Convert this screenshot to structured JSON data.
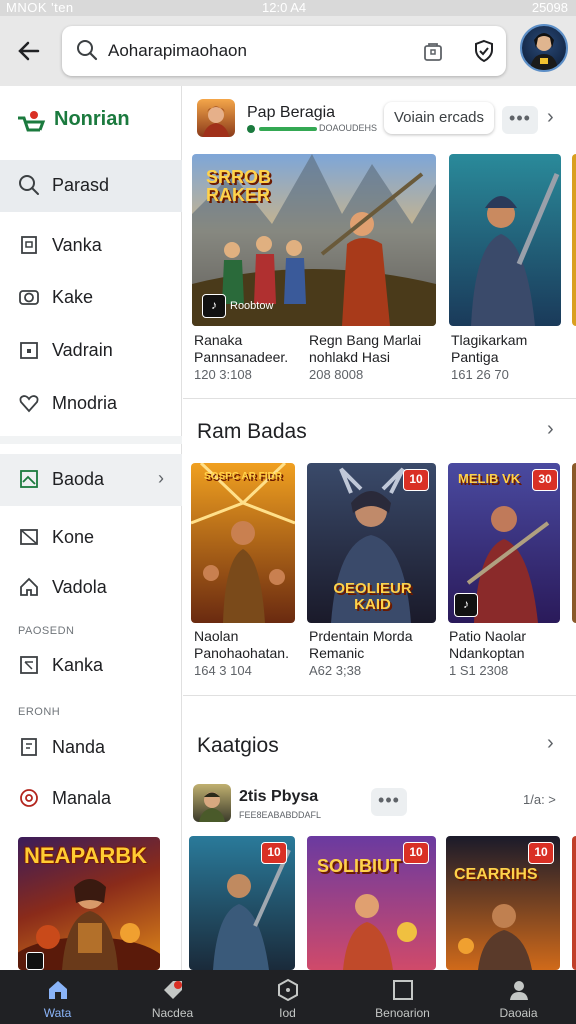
{
  "status": {
    "left": "MNOK 'ten",
    "time": "12:0 A4",
    "right": "25098"
  },
  "search": {
    "value": "Aoharapimaohaon",
    "placeholder": ""
  },
  "sidebar": {
    "brand": "Nonrian",
    "items": [
      {
        "label": "Parasd",
        "icon": "search-icon"
      },
      {
        "label": "Vanka",
        "icon": "document-icon"
      },
      {
        "label": "Kake",
        "icon": "camera-icon"
      },
      {
        "label": "Vadrain",
        "icon": "calendar-icon"
      },
      {
        "label": "Mnodria",
        "icon": "heart-icon"
      },
      {
        "label": "Baoda",
        "icon": "image-icon"
      },
      {
        "label": "Kone",
        "icon": "picture-icon"
      },
      {
        "label": "Vadola",
        "icon": "home-icon"
      },
      {
        "label": "Kanka",
        "icon": "frame-icon"
      },
      {
        "label": "Nanda",
        "icon": "file-icon"
      },
      {
        "label": "Manala",
        "icon": "target-icon"
      }
    ],
    "section1": "PAOSEDN",
    "section2": "ERONH",
    "card_title": "NEAPARBK"
  },
  "featured": {
    "app_name": "Pap Beragia",
    "app_sub": "DOAOUDEHS",
    "action_label": "Voiain ercads"
  },
  "row1": [
    {
      "title1": "Ranaka",
      "title2": "Pannsanadeer.",
      "meta": "120 3:108",
      "badge": "Roobtow",
      "logo": "SRROB RAKER"
    },
    {
      "title1": "Regn Bang Marlai",
      "title2": "nohlakd Hasi",
      "meta": "208 8008",
      "badge": "",
      "logo": ""
    },
    {
      "title1": "Tlagikarkam",
      "title2": "Pantiga",
      "meta": "161 26 70",
      "badge": "",
      "logo": ""
    }
  ],
  "section_title_1": "Ram Badas",
  "row2": [
    {
      "title1": "Naolan",
      "title2": "Panohaohatan.",
      "meta": "164 3 104",
      "logo": "SOSPC AR FIDR",
      "badge": ""
    },
    {
      "title1": "Prdentain Morda",
      "title2": "Remanic",
      "meta": "A62 3;38",
      "logo": "OEOLIEUR KAID",
      "badge": "10"
    },
    {
      "title1": "Patio Naolar",
      "title2": "Ndankoptan",
      "meta": "1 S1 2308",
      "logo": "MELIB VK",
      "badge": "30"
    }
  ],
  "section_title_2": "Kaatgios",
  "featured2": {
    "app_name": "2tis Pbysa",
    "app_sub": "FEE8EABABDDAFL",
    "count": "1/a: >"
  },
  "row3": [
    {
      "logo": "",
      "badge": "10"
    },
    {
      "logo": "SOLIBIUT",
      "badge": "10"
    },
    {
      "logo": "CEARRIHS",
      "badge": "10"
    }
  ],
  "bottomnav": [
    {
      "label": "Wata",
      "icon": "home-icon"
    },
    {
      "label": "Nacdea",
      "icon": "tag-icon"
    },
    {
      "label": "Iod",
      "icon": "hexagon-icon"
    },
    {
      "label": "Benoarion",
      "icon": "square-icon"
    },
    {
      "label": "Daoaia",
      "icon": "person-icon"
    }
  ],
  "colors": {
    "brand": "#1b7a3e",
    "accent": "#8ab4f8",
    "badge_red": "#d93025"
  }
}
